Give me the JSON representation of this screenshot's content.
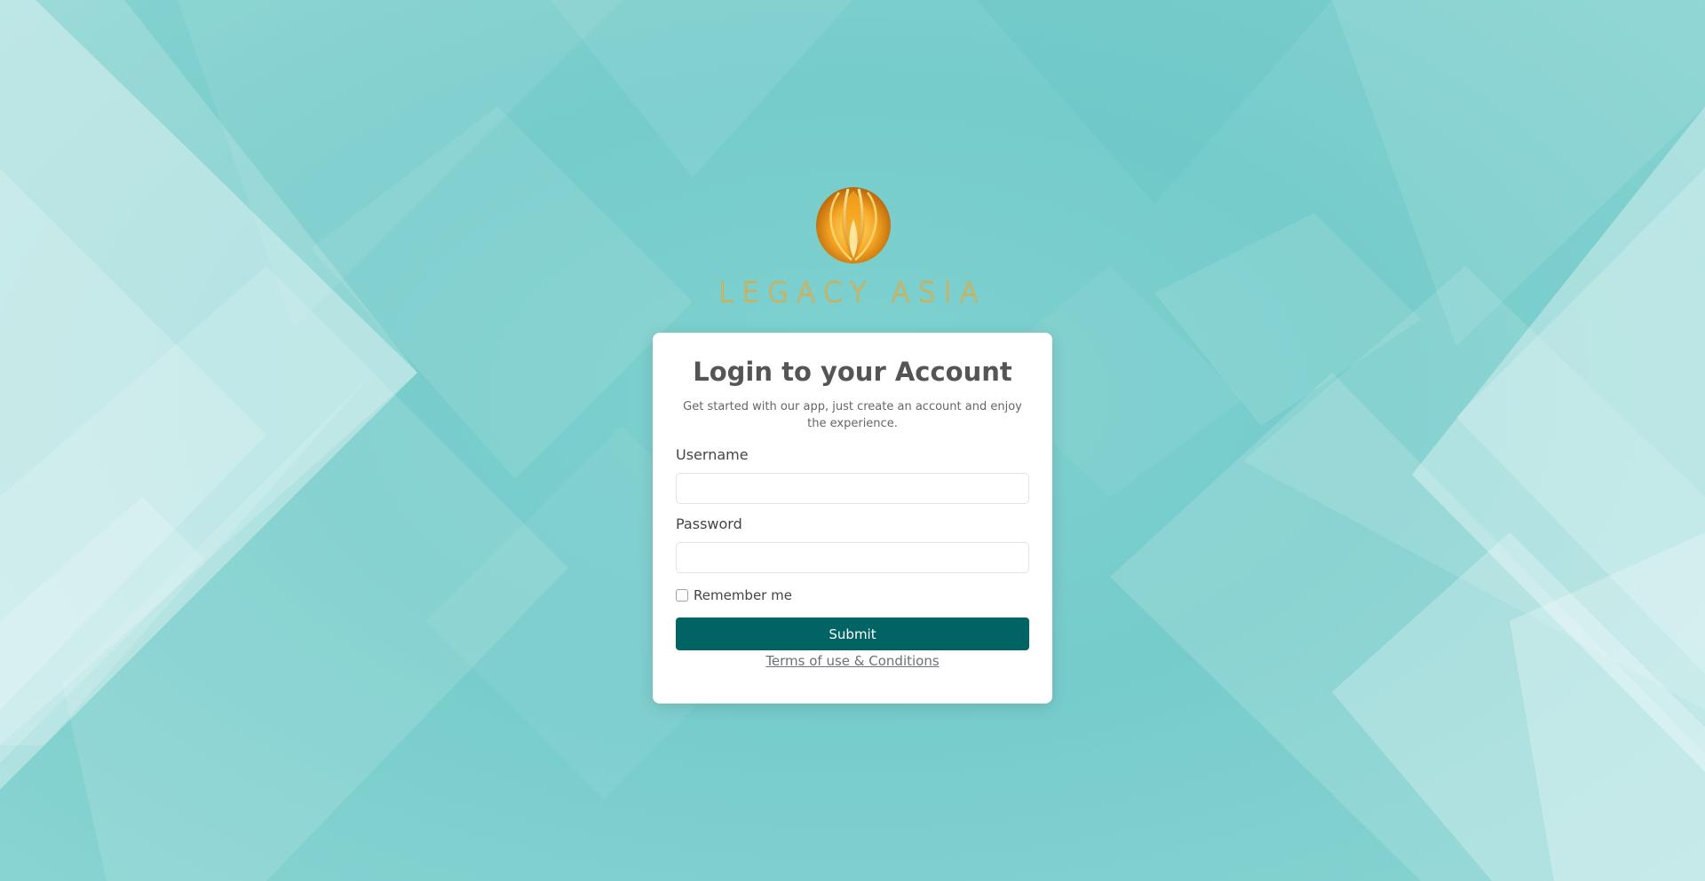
{
  "brand": {
    "name": "LEGACY ASIA"
  },
  "login": {
    "title": "Login to your Account",
    "subtitle": "Get started with our app, just create an account and enjoy the experience.",
    "username_label": "Username",
    "username_value": "",
    "password_label": "Password",
    "password_value": "",
    "remember_label": "Remember me",
    "remember_checked": false,
    "submit_label": "Submit",
    "terms_link": "Terms of use & Conditions"
  },
  "colors": {
    "background": "#7dcfcd",
    "primary_button": "#016464",
    "brand_gold": "#d8a945"
  },
  "icons": {
    "logo": "lotus-flame-logo-icon"
  }
}
